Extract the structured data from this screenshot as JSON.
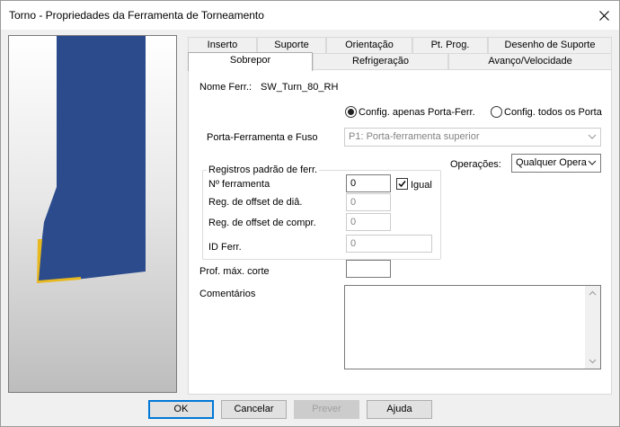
{
  "window": {
    "title": "Torno - Propriedades da Ferramenta de Torneamento"
  },
  "tabs": {
    "row1": [
      "Inserto",
      "Suporte",
      "Orientação",
      "Pt. Prog.",
      "Desenho de Suporte"
    ],
    "row2": [
      "Sobrepor",
      "Refrigeração",
      "Avanço/Velocidade"
    ]
  },
  "form": {
    "tool_name_label": "Nome Ferr.:",
    "tool_name_value": "SW_Turn_80_RH",
    "radio_holder_only": "Config. apenas Porta-Ferr.",
    "radio_all_holders": "Config. todos os Porta",
    "holder_spindle_label": "Porta-Ferramenta e Fuso",
    "holder_spindle_value": "P1: Porta-ferramenta superior",
    "operations_label": "Operações:",
    "operations_value": "Qualquer Opera",
    "group_title": "Registros padrão de ferr.",
    "tool_number_label": "Nº ferramenta",
    "tool_number_value": "0",
    "equal_label": "Igual",
    "equal_checked": true,
    "dia_offset_label": "Reg. de offset de diâ.",
    "dia_offset_value": "0",
    "length_offset_label": "Reg. de offset de compr.",
    "length_offset_value": "0",
    "tool_id_label": "ID Ferr.",
    "tool_id_value": "0",
    "max_depth_label": "Prof. máx. corte",
    "max_depth_value": "",
    "comments_label": "Comentários",
    "comments_value": ""
  },
  "buttons": {
    "ok": "OK",
    "cancel": "Cancelar",
    "preview": "Prever",
    "help": "Ajuda"
  },
  "colors": {
    "tool_body": "#2b4b8c",
    "insert": "#e8b820",
    "focus": "#0078d7"
  }
}
